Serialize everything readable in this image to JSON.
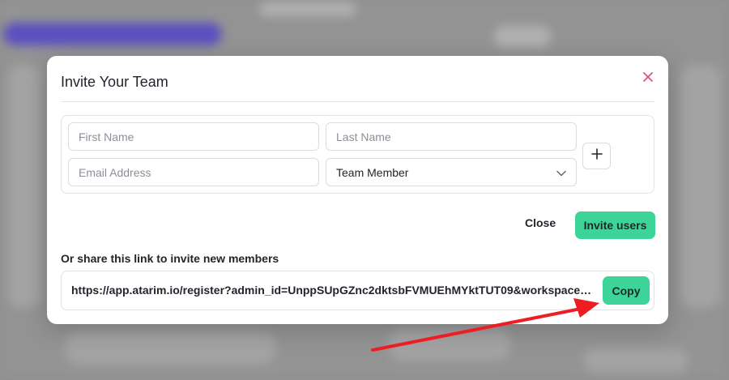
{
  "modal": {
    "title": "Invite Your Team",
    "close_icon": "close-icon"
  },
  "form": {
    "first_name_placeholder": "First Name",
    "last_name_placeholder": "Last Name",
    "email_placeholder": "Email Address",
    "role_selected": "Team Member",
    "add_row_icon": "plus-icon"
  },
  "actions": {
    "close_label": "Close",
    "invite_label": "Invite users"
  },
  "share": {
    "label": "Or share this link to invite new members",
    "link": "https://app.atarim.io/register?admin_id=UnppSUpGZnc2dktsbFVMUEhMYktTUT09&workspace_id=49...",
    "copy_label": "Copy"
  },
  "colors": {
    "accent": "#3dd49a",
    "close_icon": "#e0567a",
    "annotation_arrow": "#ee1d23"
  }
}
